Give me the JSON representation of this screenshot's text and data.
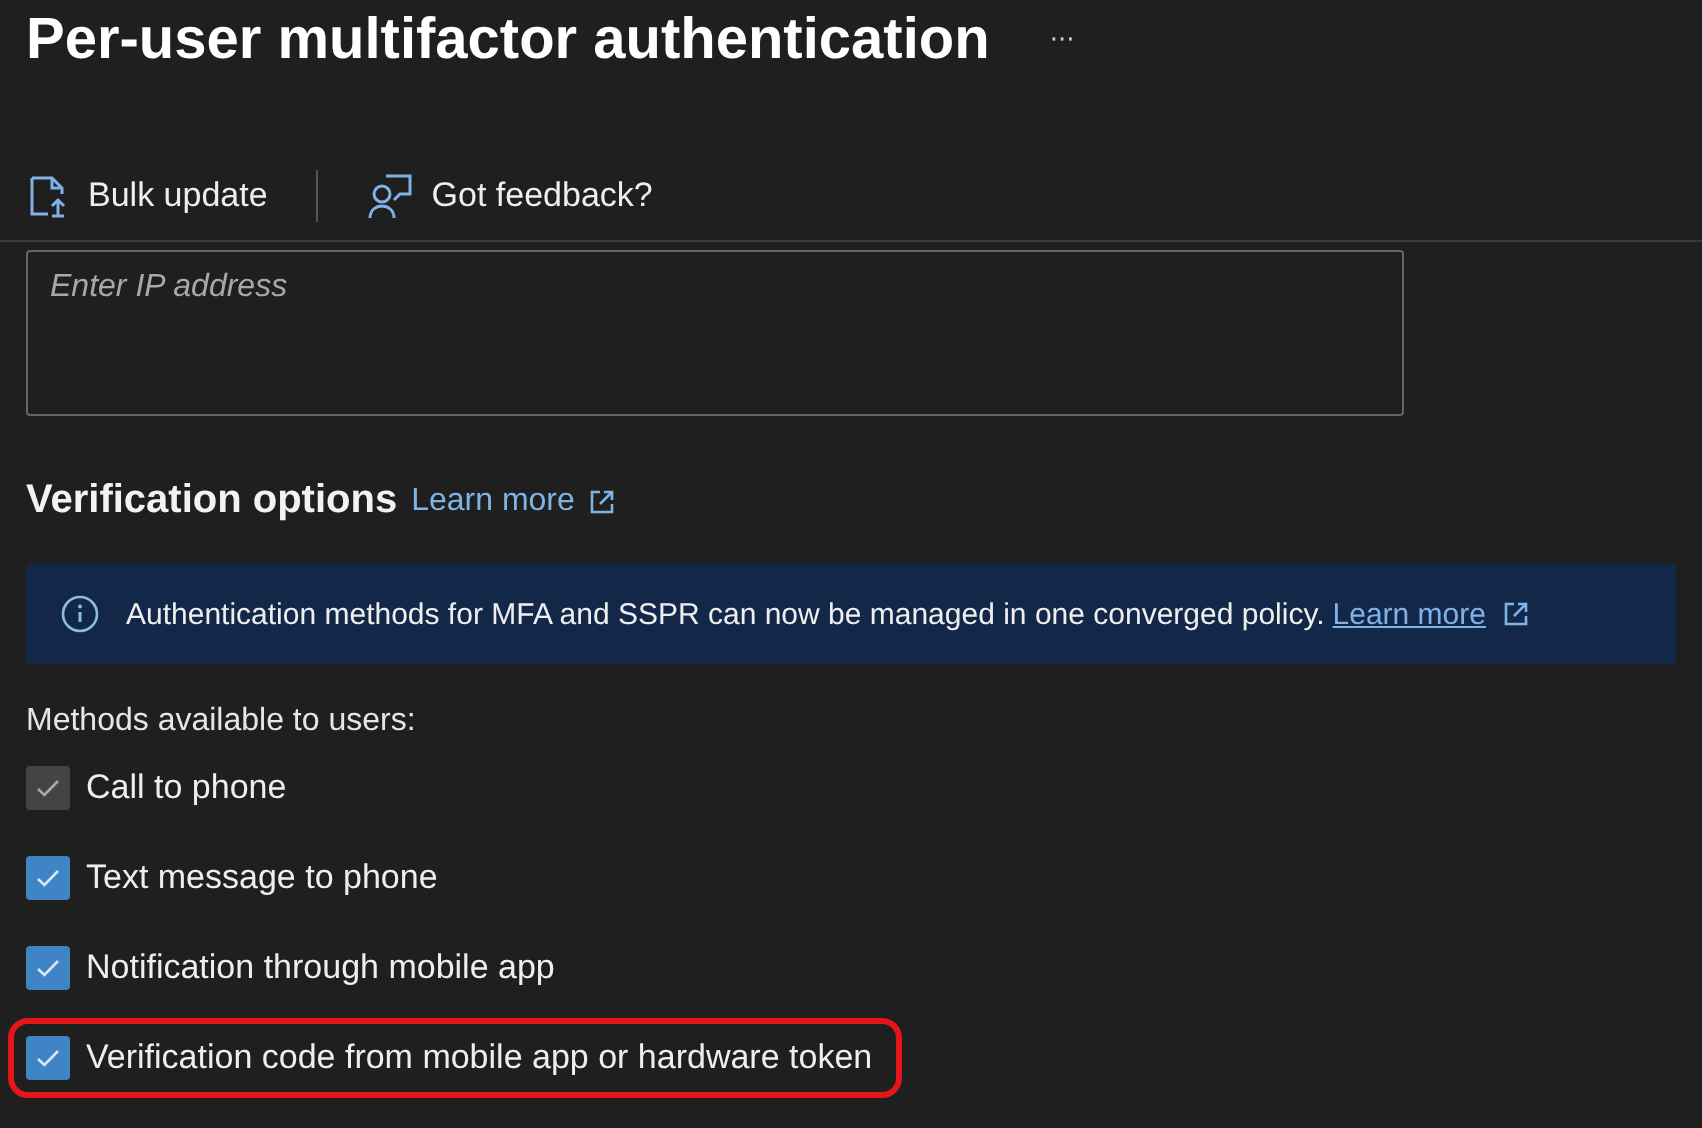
{
  "page": {
    "title": "Per-user multifactor authentication",
    "more": "···"
  },
  "toolbar": [
    {
      "label": "Bulk update",
      "kind": "bulk"
    },
    {
      "label": "Got feedback?",
      "kind": "feedback"
    }
  ],
  "ip_field": {
    "placeholder": "Enter IP address"
  },
  "section": {
    "title": "Verification options",
    "link": "Learn more"
  },
  "banner": {
    "text": "Authentication methods for MFA and SSPR can now be managed in one converged policy.",
    "link": "Learn more"
  },
  "methods_label": "Methods available to users:",
  "methods": [
    {
      "label": "Call to phone",
      "checked": true,
      "disabled": true,
      "highlighted": false
    },
    {
      "label": "Text message to phone",
      "checked": true,
      "disabled": false,
      "highlighted": false
    },
    {
      "label": "Notification through mobile app",
      "checked": true,
      "disabled": false,
      "highlighted": false
    },
    {
      "label": "Verification code from mobile app or hardware token",
      "checked": true,
      "disabled": false,
      "highlighted": true
    }
  ]
}
